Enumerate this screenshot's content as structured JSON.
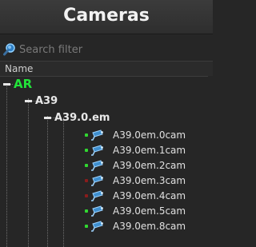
{
  "window": {
    "title": "Cameras"
  },
  "search": {
    "placeholder": "Search filter"
  },
  "tree_header": {
    "column_name": "Name"
  },
  "tree": {
    "root": {
      "label": "AR"
    },
    "group": {
      "label": "A39"
    },
    "subgroup": {
      "label": "A39.0.em"
    },
    "cameras": [
      {
        "label": "A39.0em.0cam",
        "status_color": "#31d831"
      },
      {
        "label": "A39.0em.1cam",
        "status_color": "#31d831"
      },
      {
        "label": "A39.0em.2cam",
        "status_color": "#31d831"
      },
      {
        "label": "A39.0em.3cam",
        "status_color": "#8a1c1c"
      },
      {
        "label": "A39.0em.4cam",
        "status_color": "#8a1c1c"
      },
      {
        "label": "A39.0em.5cam",
        "status_color": "#31d831"
      },
      {
        "label": "A39.0em.8cam",
        "status_color": "#31d831"
      }
    ]
  },
  "colors": {
    "root_label": "#22e33a",
    "background": "#262626",
    "camera_icon": "#6fb6e8"
  },
  "icons": {
    "search": "magnifier-icon",
    "camera": "security-camera-icon",
    "expander": "collapse-minus-icon"
  }
}
